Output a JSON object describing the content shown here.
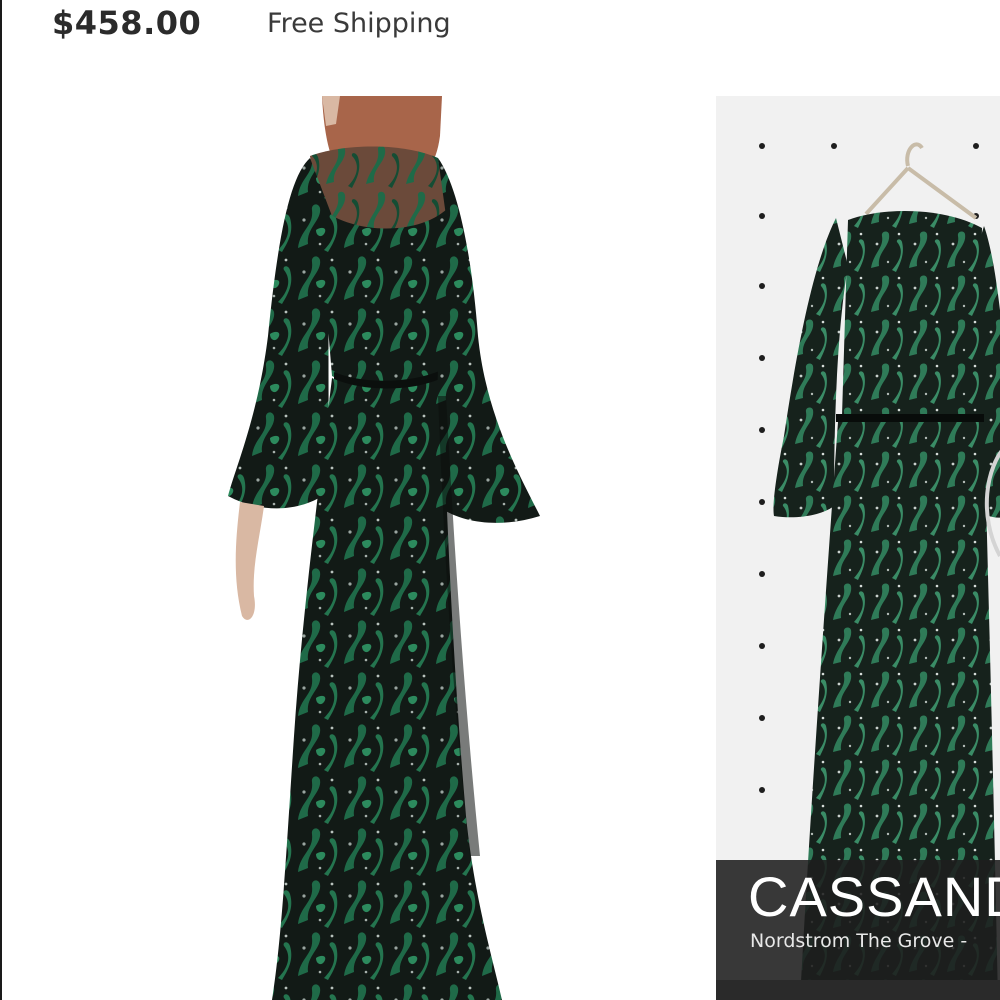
{
  "listing": {
    "price": "$458.00",
    "shipping": "Free Shipping"
  },
  "photos": {
    "secondary_caption": {
      "store": "CASSAND",
      "location": "Nordstrom The Grove -"
    }
  },
  "colors": {
    "dress_green": "#1f6a48",
    "dress_black": "#121a16",
    "skin": "#d9b8a3",
    "hair": "#a8654a",
    "wall": "#f1f1f1",
    "caption_bg": "#1e1e1e"
  },
  "icons": [
    "hanger-icon"
  ]
}
